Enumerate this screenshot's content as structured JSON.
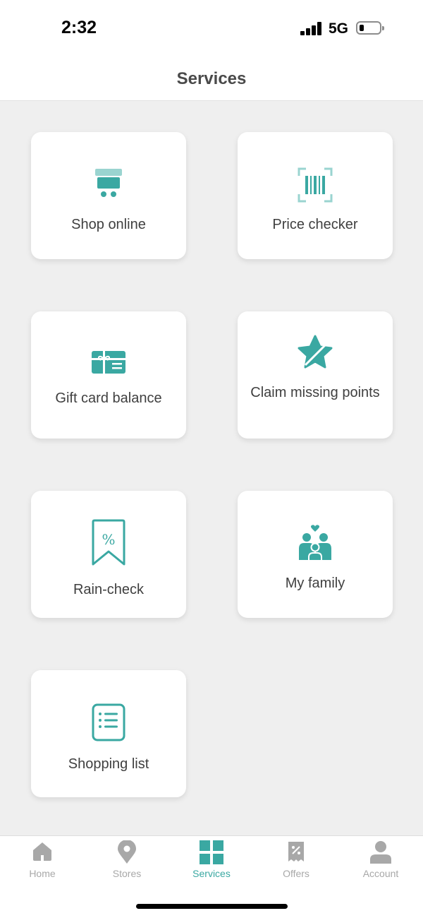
{
  "status_bar": {
    "time": "2:32",
    "network": "5G"
  },
  "header": {
    "title": "Services"
  },
  "services": [
    {
      "label": "Shop online",
      "icon": "cart-icon"
    },
    {
      "label": "Price checker",
      "icon": "barcode-icon"
    },
    {
      "label": "Gift card balance",
      "icon": "gift-card-icon"
    },
    {
      "label": "Claim missing points",
      "icon": "star-icon"
    },
    {
      "label": "Rain-check",
      "icon": "percent-tag-icon"
    },
    {
      "label": "My family",
      "icon": "family-icon"
    },
    {
      "label": "Shopping list",
      "icon": "list-icon"
    }
  ],
  "tabs": [
    {
      "label": "Home",
      "icon": "home-icon",
      "active": false
    },
    {
      "label": "Stores",
      "icon": "location-pin-icon",
      "active": false
    },
    {
      "label": "Services",
      "icon": "grid-icon",
      "active": true
    },
    {
      "label": "Offers",
      "icon": "coupon-icon",
      "active": false
    },
    {
      "label": "Account",
      "icon": "person-icon",
      "active": false
    }
  ],
  "colors": {
    "accent": "#3aa8a2",
    "inactive": "#a8a8a8",
    "background": "#efefef"
  }
}
